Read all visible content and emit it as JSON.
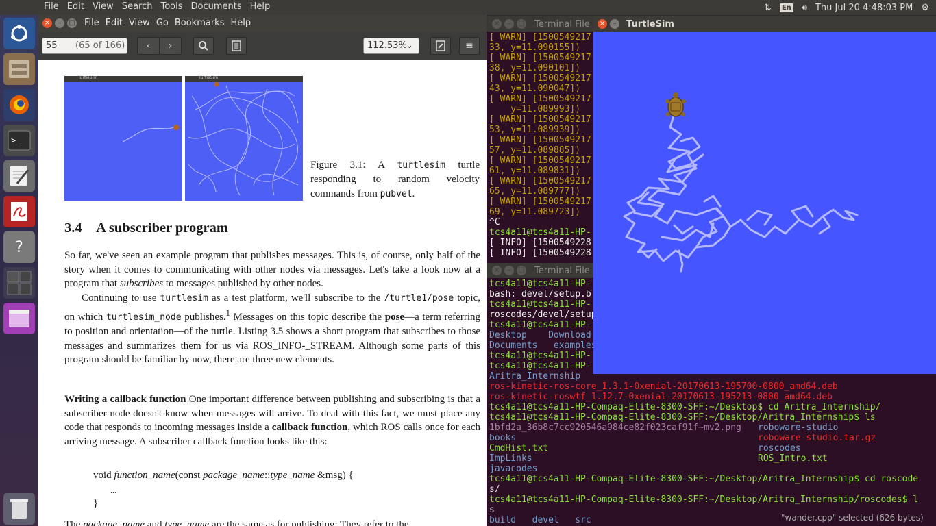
{
  "topbar": {
    "menu": [
      "File",
      "Edit",
      "View",
      "Search",
      "Tools",
      "Documents",
      "Help"
    ],
    "keyboard": "En",
    "clock": "Thu Jul 20  4:48:03 PM"
  },
  "launcher": {
    "items": [
      "ubuntu-dash",
      "files",
      "firefox",
      "terminal",
      "text-editor",
      "document-viewer",
      "help",
      "workspace-switcher",
      "software",
      "trash"
    ]
  },
  "evince": {
    "menu": [
      "File",
      "Edit",
      "View",
      "Go",
      "Bookmarks",
      "Help"
    ],
    "page_number": "55",
    "page_of": "(65 of 166)",
    "zoom": "112.53%",
    "document": {
      "fig_titles": [
        "TurtleSim",
        "TurtleSim"
      ],
      "caption_prefix": "Figure 3.1:  A ",
      "caption_code": "turtlesim",
      "caption_rest": " turtle responding to random velocity commands from ",
      "caption_code2": "pubvel",
      "caption_end": ".",
      "section_number": "3.4",
      "section_title": "A subscriber program",
      "p1_a": "So far, we've seen an example program that publishes messages. This is, of course, only half of the story when it comes to communicating with other nodes via messages. Let's take a look now at a program that ",
      "p1_em": "subscribes",
      "p1_b": " to messages published by other nodes.",
      "p2_a": "Continuing to use ",
      "p2_code1": "turtlesim",
      "p2_b": " as a test platform, we'll subscribe to the ",
      "p2_code2": "/turtle1/pose",
      "p2_c": " topic, on which ",
      "p2_code3": "turtlesim_node",
      "p2_d": " publishes.",
      "p2_sup": "1",
      "p2_e": " Messages on this topic describe the ",
      "p2_bold": "pose",
      "p2_f": "—a term referring to position and orientation—of the turtle. Listing 3.5 shows a short program that subscribes to those messages and summarizes them for us via ROS_INFO-_STREAM. Although some parts of this program should be familiar by now, there are three new elements.",
      "p3_bold": "Writing a callback function",
      "p3_a": "  One important difference between publishing and subscribing is that a subscriber node doesn't know when messages will arrive. To deal with this fact, we must place any code that responds to incoming messages inside a ",
      "p3_bold2": "callback function",
      "p3_b": ", which ROS calls once for each arriving message. A subscriber callback function looks like this:",
      "code_l1_a": "void ",
      "code_l1_em": "function_name",
      "code_l1_b": "(const ",
      "code_l1_em2": "package_name",
      "code_l1_c": "::",
      "code_l1_em3": "type_name",
      "code_l1_d": " &msg) {",
      "code_l2": "...",
      "code_l3": "}",
      "p4_a": "The ",
      "p4_em": "package_name",
      "p4_b": " and ",
      "p4_em2": "type_name",
      "p4_c": " are the same as for publishing: They refer to the"
    }
  },
  "terminal1": {
    "title": "Terminal  File",
    "lines": [
      {
        "t": "[ WARN] [1500549217",
        "c": "warn"
      },
      {
        "t": "33, y=11.090155])",
        "c": "warn"
      },
      {
        "t": "[ WARN] [1500549217",
        "c": "warn"
      },
      {
        "t": "38, y=11.090101])",
        "c": "warn"
      },
      {
        "t": "[ WARN] [1500549217",
        "c": "warn"
      },
      {
        "t": "43, y=11.090047])",
        "c": "warn"
      },
      {
        "t": "[ WARN] [1500549217",
        "c": "warn"
      },
      {
        "t": "    y=11.089993])",
        "c": "warn"
      },
      {
        "t": "[ WARN] [1500549217",
        "c": "warn"
      },
      {
        "t": "53, y=11.089939])",
        "c": "warn"
      },
      {
        "t": "[ WARN] [1500549217",
        "c": "warn"
      },
      {
        "t": "57, y=11.089885])",
        "c": "warn"
      },
      {
        "t": "[ WARN] [1500549217",
        "c": "warn"
      },
      {
        "t": "61, y=11.089831])",
        "c": "warn"
      },
      {
        "t": "[ WARN] [1500549217",
        "c": "warn"
      },
      {
        "t": "65, y=11.089777])",
        "c": "warn"
      },
      {
        "t": "[ WARN] [1500549217",
        "c": "warn"
      },
      {
        "t": "69, y=11.089723])",
        "c": "warn"
      },
      {
        "t": "^C",
        "c": "white"
      },
      {
        "t": "tcs4a11@tcs4a11-HP-",
        "c": "green"
      },
      {
        "t": "[ INFO] [1500549228",
        "c": "white"
      },
      {
        "t": "[ INFO] [1500549228",
        "c": "white"
      }
    ]
  },
  "terminal2": {
    "title": "Terminal  File",
    "lines": [
      {
        "t": "tcs4a11@tcs4a11-HP-",
        "c": "green"
      },
      {
        "t": "bash: devel/setup.b",
        "c": "white"
      },
      {
        "t": "tcs4a11@tcs4a11-HP-",
        "c": "green"
      },
      {
        "t": "roscodes/devel/setup",
        "c": "white"
      },
      {
        "t": "tcs4a11@tcs4a11-HP-",
        "c": "green"
      },
      {
        "t": "Desktop    Download",
        "c": "blue"
      },
      {
        "t": "Documents   examples",
        "c": "blue"
      },
      {
        "t": "tcs4a11@tcs4a11-HP-",
        "c": "green"
      },
      {
        "t": "tcs4a11@tcs4a11-HP-",
        "c": "green"
      },
      {
        "t": "Aritra_Internship",
        "c": "blue"
      },
      {
        "t": "ros-kinetic-ros-core_1.3.1-0xenial-20170613-195700-0800_amd64.deb",
        "c": "red"
      },
      {
        "t": "ros-kinetic-roswtf_1.12.7-0xenial-20170613-195213-0800_amd64.deb",
        "c": "red"
      },
      {
        "t": "tcs4a11@tcs4a11-HP-Compaq-Elite-8300-SFF:~/Desktop$ cd Aritra_Internship/",
        "c": "green"
      },
      {
        "t": "tcs4a11@tcs4a11-HP-Compaq-Elite-8300-SFF:~/Desktop/Aritra_Internship$ ls",
        "c": "green"
      },
      {
        "t": "1bfd2a_36b8c7cc920546a984ce82f023caf91f~mv2.png",
        "c": "magenta",
        "t2": "roboware-studio",
        "c2": "blue"
      },
      {
        "t": "books",
        "c": "blue",
        "t2": "roboware-studio.tar.gz",
        "c2": "red"
      },
      {
        "t": "CmdHist.txt",
        "c": "green",
        "t2": "roscodes",
        "c2": "blue"
      },
      {
        "t": "ImpLinks",
        "c": "blue",
        "t2": "ROS_Intro.txt",
        "c2": "green"
      },
      {
        "t": "javacodes",
        "c": "blue"
      },
      {
        "t": "tcs4a11@tcs4a11-HP-Compaq-Elite-8300-SFF:~/Desktop/Aritra_Internship$ cd roscode",
        "c": "green"
      },
      {
        "t": "s/",
        "c": "white"
      },
      {
        "t": "tcs4a11@tcs4a11-HP-Compaq-Elite-8300-SFF:~/Desktop/Aritra_Internship/roscodes$ l",
        "c": "green"
      },
      {
        "t": "s",
        "c": "white"
      },
      {
        "t": "build   devel   src",
        "c": "blue"
      }
    ],
    "status": "\"wander.cpp\" selected  (626 bytes)"
  },
  "turtlesim": {
    "title": "TurtleSim",
    "background": "#4555ff",
    "trail_color": "#b3b8ff"
  },
  "colors": {
    "panel": "#3c3b37",
    "close_button": "#e9532a",
    "terminal_bg": "#2c0f24"
  }
}
